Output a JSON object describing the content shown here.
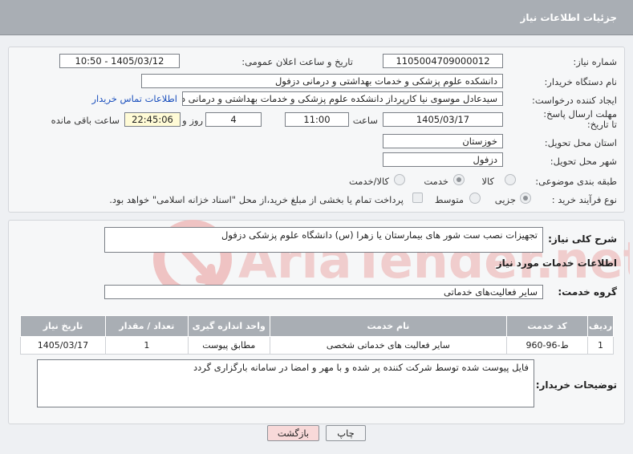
{
  "header": {
    "title": "جزئیات اطلاعات نیاز"
  },
  "form": {
    "need_number_label": "شماره نیاز:",
    "need_number": "1105004709000012",
    "announce_label": "تاریخ و ساعت اعلان عمومی:",
    "announce_value": "1405/03/12 - 10:50",
    "buyer_org_label": "نام دستگاه خریدار:",
    "buyer_org": "دانشکده علوم پزشکی و خدمات بهداشتی و درمانی دزفول",
    "creator_label": "ایجاد کننده درخواست:",
    "creator": "سیدعادل موسوی نیا کارپرداز دانشکده علوم پزشکی و خدمات بهداشتی و درمانی دزفول",
    "contact_link": "اطلاعات تماس خریدار",
    "deadline_label": "مهلت ارسال پاسخ: تا تاریخ:",
    "deadline_date": "1405/03/17",
    "time_label": "ساعت",
    "deadline_time": "11:00",
    "days_value": "4",
    "days_label": "روز و",
    "remaining_time": "22:45:06",
    "remaining_label": "ساعت باقی مانده",
    "province_label": "استان محل تحویل:",
    "province": "خوزستان",
    "city_label": "شهر محل تحویل:",
    "city": "دزفول",
    "category_label": "طبقه بندی موضوعی:",
    "category_options": [
      "کالا",
      "خدمت",
      "کالا/خدمت"
    ],
    "category_selected": "خدمت",
    "process_label": "نوع فرآیند خرید :",
    "process_options": [
      "جزیی",
      "متوسط"
    ],
    "payment_note": "پرداخت تمام یا بخشی از مبلغ خرید،از محل \"اسناد خزانه اسلامی\" خواهد بود."
  },
  "summary": {
    "label": "شرح کلی نیاز:",
    "text": "تجهیزات نصب ست شور های بیمارستان یا زهرا (س) دانشگاه علوم پزشکی دزفول"
  },
  "services": {
    "heading": "اطلاعات خدمات مورد نیاز",
    "group_label": "گروه خدمت:",
    "group_value": "سایر فعالیت‌های خدماتی",
    "table": {
      "headers": [
        "ردیف",
        "کد خدمت",
        "نام خدمت",
        "واحد اندازه گیری",
        "تعداد / مقدار",
        "تاریخ نیاز"
      ],
      "rows": [
        [
          "1",
          "ط-96-960",
          "سایر فعالیت های خدماتی شخصی",
          "مطابق پیوست",
          "1",
          "1405/03/17"
        ]
      ]
    }
  },
  "buyer_notes": {
    "label": "توضیحات خریدار:",
    "text": "فایل پیوست شده توسط شرکت کننده پر شده و با مهر و امضا در سامانه بارگزاری گردد"
  },
  "buttons": {
    "print": "چاپ",
    "back": "بازگشت"
  },
  "watermark": {
    "text": "AriaTender.net"
  },
  "colors": {
    "header_bg": "#a9aeb4",
    "link": "#1a4fbd",
    "back_button_bg": "#f8d9d9",
    "watermark": "#e9b9b9"
  }
}
